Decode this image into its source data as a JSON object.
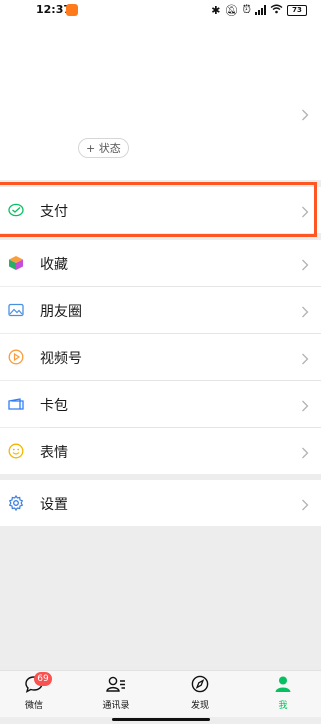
{
  "status_bar": {
    "time": "12:37",
    "battery": "73"
  },
  "profile": {
    "status_button_label": "+ 状态"
  },
  "menu": {
    "pay": "支付",
    "favorites": "收藏",
    "moments": "朋友圈",
    "channels": "视频号",
    "cards": "卡包",
    "stickers": "表情",
    "settings": "设置"
  },
  "tabbar": {
    "chats": {
      "label": "微信",
      "badge": "69"
    },
    "contacts": {
      "label": "通讯录"
    },
    "discover": {
      "label": "发现"
    },
    "me": {
      "label": "我"
    }
  },
  "colors": {
    "accent_green": "#07c160",
    "highlight": "#ff5722",
    "badge_red": "#fa5151",
    "background": "#ededed"
  },
  "icons": [
    "wechat-pay-icon",
    "favorites-cube-icon",
    "moments-image-icon",
    "channels-play-icon",
    "card-wallet-icon",
    "sticker-smile-icon",
    "settings-gear-icon",
    "chat-bubble-icon",
    "contacts-icon",
    "compass-icon",
    "person-icon"
  ]
}
